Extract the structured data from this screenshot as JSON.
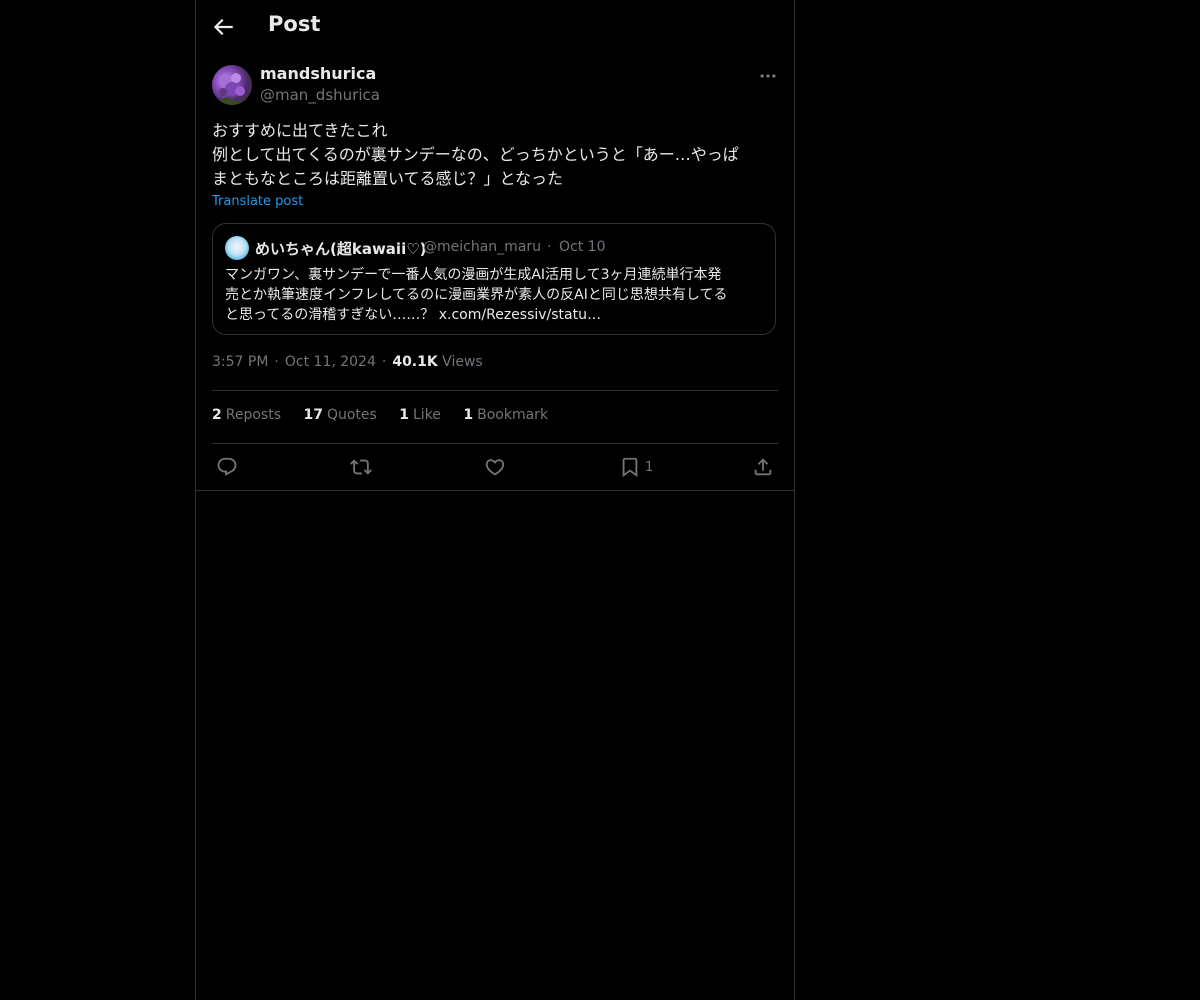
{
  "header": {
    "title": "Post",
    "back_icon": "arrow-left-icon"
  },
  "post": {
    "author_name": "mandshurica",
    "author_handle": "@man_dshurica",
    "text": "おすすめに出てきたこれ\n例として出てくるのが裏サンデーなの、どっちかというと「あー…やっぱ\nまともなところは距離置いてる感じ？」となった",
    "translate_label": "Translate post",
    "time": "3:57 PM",
    "date": "Oct 11, 2024",
    "views_count": "40.1K",
    "views_label": "Views"
  },
  "quote": {
    "author_name": "めいちゃん(超kawaii♡)",
    "author_handle": "@meichan_maru",
    "separator": "·",
    "date": "Oct 10",
    "text": "マンガワン、裏サンデーで一番人気の漫画が生成AI活用して3ヶ月連続単行本発\n売とか執筆速度インフレしてるのに漫画業界が素人の反AIと同じ思想共有してる\nと思ってるの滑稽すぎない……？ x.com/Rezessiv/statu…"
  },
  "stats": {
    "reposts_count": "2",
    "reposts_label": "Reposts",
    "quotes_count": "17",
    "quotes_label": "Quotes",
    "likes_count": "1",
    "likes_label": "Like",
    "bookmarks_count": "1",
    "bookmarks_label": "Bookmark"
  },
  "actions": {
    "reply_icon": "reply-icon",
    "repost_icon": "repost-icon",
    "like_icon": "heart-icon",
    "bookmark_icon": "bookmark-icon",
    "bookmark_count": "1",
    "share_icon": "share-icon"
  },
  "colors": {
    "background": "#000000",
    "text": "#e7e9ea",
    "secondary": "#71767b",
    "accent": "#1d9bf0",
    "border": "#2f3336"
  }
}
